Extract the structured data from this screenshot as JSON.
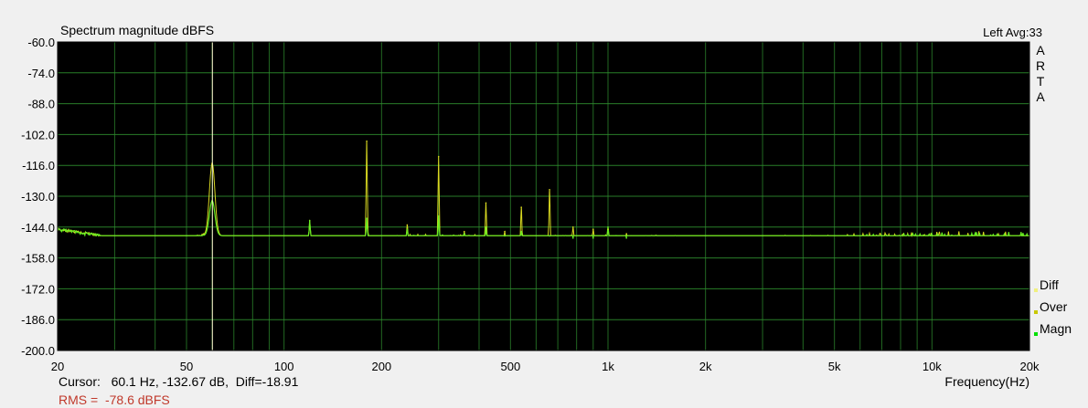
{
  "window": {
    "title": "Spectrum magnitude dBFS",
    "channel": "Left  Avg:33",
    "brand_letters": [
      "A",
      "R",
      "T",
      "A"
    ]
  },
  "status": {
    "cursor": "Cursor:   60.1 Hz, -132.67 dB,  Diff=-18.91",
    "rms": "RMS =  -78.6 dBFS"
  },
  "legend": [
    {
      "label": "Diff",
      "color": "#f0f080"
    },
    {
      "label": "Over",
      "color": "#c8c800"
    },
    {
      "label": "Magn",
      "color": "#00e000"
    }
  ],
  "colors": {
    "plot_bg": "#000000",
    "grid": "#2e8b2e",
    "magnitude": "#66ee22",
    "over": "#d8d820",
    "cursor_line": "#fff8d0"
  },
  "chart_data": {
    "type": "line",
    "title": "Spectrum magnitude dBFS",
    "xlabel": "Frequency(Hz)",
    "ylabel": "",
    "x_scale": "log",
    "xlim": [
      20,
      20000
    ],
    "ylim": [
      -200,
      -60
    ],
    "grid": true,
    "legend_position": "bottom-right",
    "x_ticks": [
      20,
      50,
      100,
      200,
      500,
      1000,
      2000,
      5000,
      10000,
      20000
    ],
    "x_tick_labels": [
      "20",
      "50",
      "100",
      "200",
      "500",
      "1k",
      "2k",
      "5k",
      "10k",
      "20k"
    ],
    "y_ticks": [
      -60,
      -74,
      -88,
      -102,
      -116,
      -130,
      -144,
      -158,
      -172,
      -186,
      -200
    ],
    "y_tick_labels": [
      "-60.0",
      "-74.0",
      "-88.0",
      "-102.0",
      "-116.0",
      "-130.0",
      "-144.0",
      "-158.0",
      "-172.0",
      "-186.0",
      "-200.0"
    ],
    "cursor_x": 60.1,
    "noise_floor": [
      [
        20,
        -145
      ],
      [
        25,
        -147
      ],
      [
        30,
        -149
      ],
      [
        35,
        -150
      ],
      [
        40,
        -151
      ],
      [
        45,
        -150
      ],
      [
        50,
        -149
      ],
      [
        55,
        -148
      ],
      [
        58,
        -147
      ],
      [
        65,
        -150
      ],
      [
        70,
        -150
      ],
      [
        80,
        -151
      ],
      [
        90,
        -151
      ],
      [
        100,
        -150
      ],
      [
        110,
        -150
      ],
      [
        140,
        -151
      ],
      [
        160,
        -151
      ],
      [
        200,
        -151
      ],
      [
        300,
        -151
      ],
      [
        500,
        -152
      ],
      [
        1000,
        -152
      ],
      [
        2000,
        -153
      ],
      [
        5000,
        -153
      ],
      [
        10000,
        -152
      ],
      [
        20000,
        -152
      ]
    ],
    "series": [
      {
        "name": "Over",
        "peaks": [
          [
            60,
            -115
          ],
          [
            120,
            -141
          ],
          [
            180,
            -105
          ],
          [
            240,
            -143
          ],
          [
            300,
            -112
          ],
          [
            360,
            -146
          ],
          [
            420,
            -133
          ],
          [
            480,
            -146
          ],
          [
            540,
            -135
          ],
          [
            660,
            -127
          ],
          [
            780,
            -144
          ],
          [
            900,
            -145
          ],
          [
            1000,
            -145
          ],
          [
            1140,
            -147
          ]
        ]
      },
      {
        "name": "Magn",
        "peaks": [
          [
            60,
            -132
          ],
          [
            120,
            -141
          ],
          [
            180,
            -140
          ],
          [
            240,
            -145
          ],
          [
            300,
            -139
          ],
          [
            360,
            -147
          ],
          [
            420,
            -144
          ],
          [
            480,
            -148
          ],
          [
            540,
            -146
          ],
          [
            660,
            -148
          ],
          [
            780,
            -149
          ],
          [
            900,
            -149
          ],
          [
            1000,
            -144
          ],
          [
            1140,
            -149
          ]
        ]
      }
    ]
  }
}
